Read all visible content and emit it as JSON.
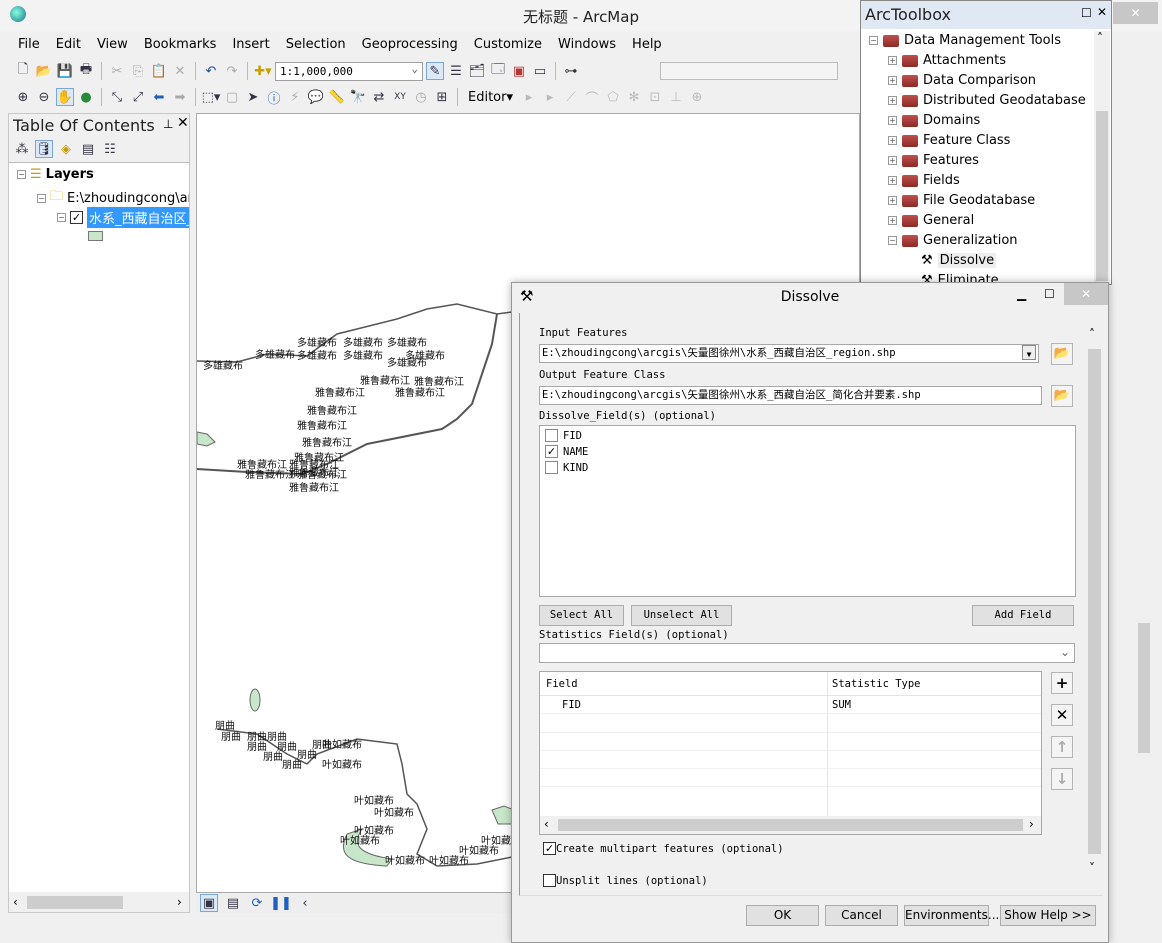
{
  "window": {
    "title": "无标题 - ArcMap",
    "app_icon": "arcmap-globe-icon"
  },
  "menu": [
    "File",
    "Edit",
    "View",
    "Bookmarks",
    "Insert",
    "Selection",
    "Geoprocessing",
    "Customize",
    "Windows",
    "Help"
  ],
  "toolbar": {
    "scale": "1:1,000,000",
    "editor_label": "Editor▾"
  },
  "toc": {
    "title": "Table Of Contents",
    "root": "Layers",
    "folder": "E:\\zhoudingcong\\ar",
    "layer": "水系_西藏自治区_r",
    "symbol_color": "#c8e6c9"
  },
  "map": {
    "labels": [
      "多雄藏布",
      "雅鲁藏布江",
      "朋曲",
      "叶如藏布"
    ],
    "fill_color": "#c8e6c9"
  },
  "toolbox": {
    "title": "ArcToolbox",
    "root": "Data Management Tools",
    "items": [
      "Attachments",
      "Data Comparison",
      "Distributed Geodatabase",
      "Domains",
      "Feature Class",
      "Features",
      "Fields",
      "File Geodatabase",
      "General",
      "Generalization"
    ],
    "tools": [
      "Dissolve",
      "Eliminate"
    ]
  },
  "dialog": {
    "title": "Dissolve",
    "input_label": "Input Features",
    "input_value": "E:\\zhoudingcong\\arcgis\\矢量图徐州\\水系_西藏自治区_region.shp",
    "output_label": "Output Feature Class",
    "output_value": "E:\\zhoudingcong\\arcgis\\矢量图徐州\\水系_西藏自治区_简化合并要素.shp",
    "dissolve_label": "Dissolve_Field(s) (optional)",
    "fields": [
      {
        "name": "FID",
        "checked": false
      },
      {
        "name": "NAME",
        "checked": true
      },
      {
        "name": "KIND",
        "checked": false
      }
    ],
    "select_all": "Select All",
    "unselect_all": "Unselect All",
    "add_field": "Add Field",
    "stats_label": "Statistics Field(s) (optional)",
    "stats_columns": [
      "Field",
      "Statistic Type"
    ],
    "stats_rows": [
      [
        "FID",
        "SUM"
      ]
    ],
    "multipart_label": "Create multipart features (optional)",
    "multipart_checked": true,
    "unsplit_label": "Unsplit lines (optional)",
    "unsplit_checked": false,
    "buttons": {
      "ok": "OK",
      "cancel": "Cancel",
      "environments": "Environments...",
      "help": "Show Help >>"
    }
  }
}
